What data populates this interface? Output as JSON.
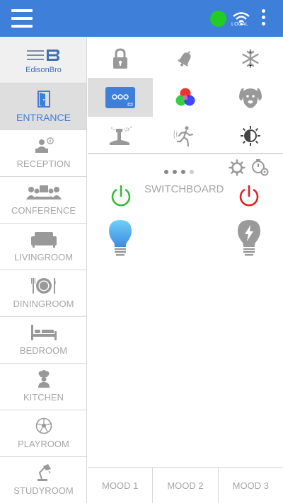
{
  "header": {
    "menu_icon": "hamburger-icon",
    "status_color": "#22cc22",
    "connection_label": "LOCAL",
    "more_icon": "vertical-dots-icon"
  },
  "sidebar": {
    "brand": "EdisonBro",
    "rooms": [
      {
        "label": "ENTRANCE",
        "icon": "door-icon",
        "active": true
      },
      {
        "label": "RECEPTION",
        "icon": "reception-desk-icon"
      },
      {
        "label": "CONFERENCE",
        "icon": "conference-icon"
      },
      {
        "label": "LIVINGROOM",
        "icon": "sofa-icon"
      },
      {
        "label": "DININGROOM",
        "icon": "dining-icon"
      },
      {
        "label": "BEDROOM",
        "icon": "bed-icon"
      },
      {
        "label": "KITCHEN",
        "icon": "chef-icon"
      },
      {
        "label": "PLAYROOM",
        "icon": "football-icon"
      },
      {
        "label": "STUDYROOM",
        "icon": "desk-lamp-icon"
      }
    ]
  },
  "devices": [
    "lock-icon",
    "bell-icon",
    "snowflake-icon",
    "switchboard-icon",
    "rgb-icon",
    "dog-icon",
    "sprinkler-icon",
    "motion-icon",
    "dimmer-icon"
  ],
  "switchboard": {
    "title": "SWITCHBOARD",
    "pages": 4,
    "current_page": 4,
    "power_on_color": "#33bb33",
    "power_off_color": "#e02020",
    "bulb_on_color": "#4db4f0",
    "bulb_off_color": "#9a9a9a"
  },
  "moods": [
    "MOOD 1",
    "MOOD 2",
    "MOOD 3"
  ],
  "accent_color": "#3d7fd9"
}
